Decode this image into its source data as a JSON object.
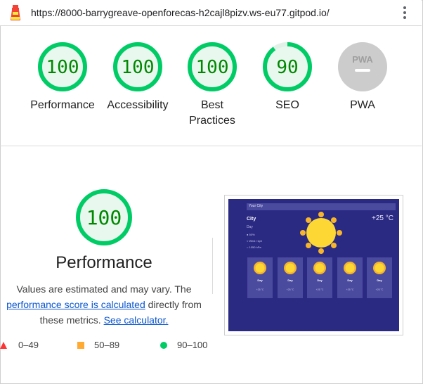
{
  "url": "https://8000-barrygreave-openforecas-h2cajl8pizv.ws-eu77.gitpod.io/",
  "colors": {
    "pass": "#00cc66",
    "pass_fill": "#e8f8ee",
    "pass_text": "#008800",
    "average": "#ffaa33",
    "fail": "#ff3333",
    "pwa_gray": "#cccccc"
  },
  "gauges": [
    {
      "label": "Performance",
      "score": 100
    },
    {
      "label": "Accessibility",
      "score": 100
    },
    {
      "label_line1": "Best",
      "label_line2": "Practices",
      "score": 100
    },
    {
      "label": "SEO",
      "score": 90
    },
    {
      "label": "PWA",
      "badge": "PWA"
    }
  ],
  "performance": {
    "score": 100,
    "title": "Performance",
    "desc_line1": "Values are estimated and may vary. The",
    "link_score": "performance score is calculated",
    "desc_mid": "directly from",
    "desc_line3": "these metrics.",
    "link_calc": "See calculator."
  },
  "legend": {
    "fail": "0–49",
    "average": "50–89",
    "pass": "90–100"
  },
  "thumbnail": {
    "search_label": "Your City",
    "city": "City",
    "day": "Day",
    "humidity": "50%",
    "wind": "West  /  kph",
    "pressure": "1050 hPa",
    "temp": "+25 °C",
    "cards": [
      {
        "day": "Day",
        "temp": "+25 °C"
      },
      {
        "day": "Day",
        "temp": "+25 °C"
      },
      {
        "day": "Day",
        "temp": "+25 °C"
      },
      {
        "day": "Day",
        "temp": "+25 °C"
      },
      {
        "day": "Day",
        "temp": "+25 °C"
      }
    ]
  }
}
